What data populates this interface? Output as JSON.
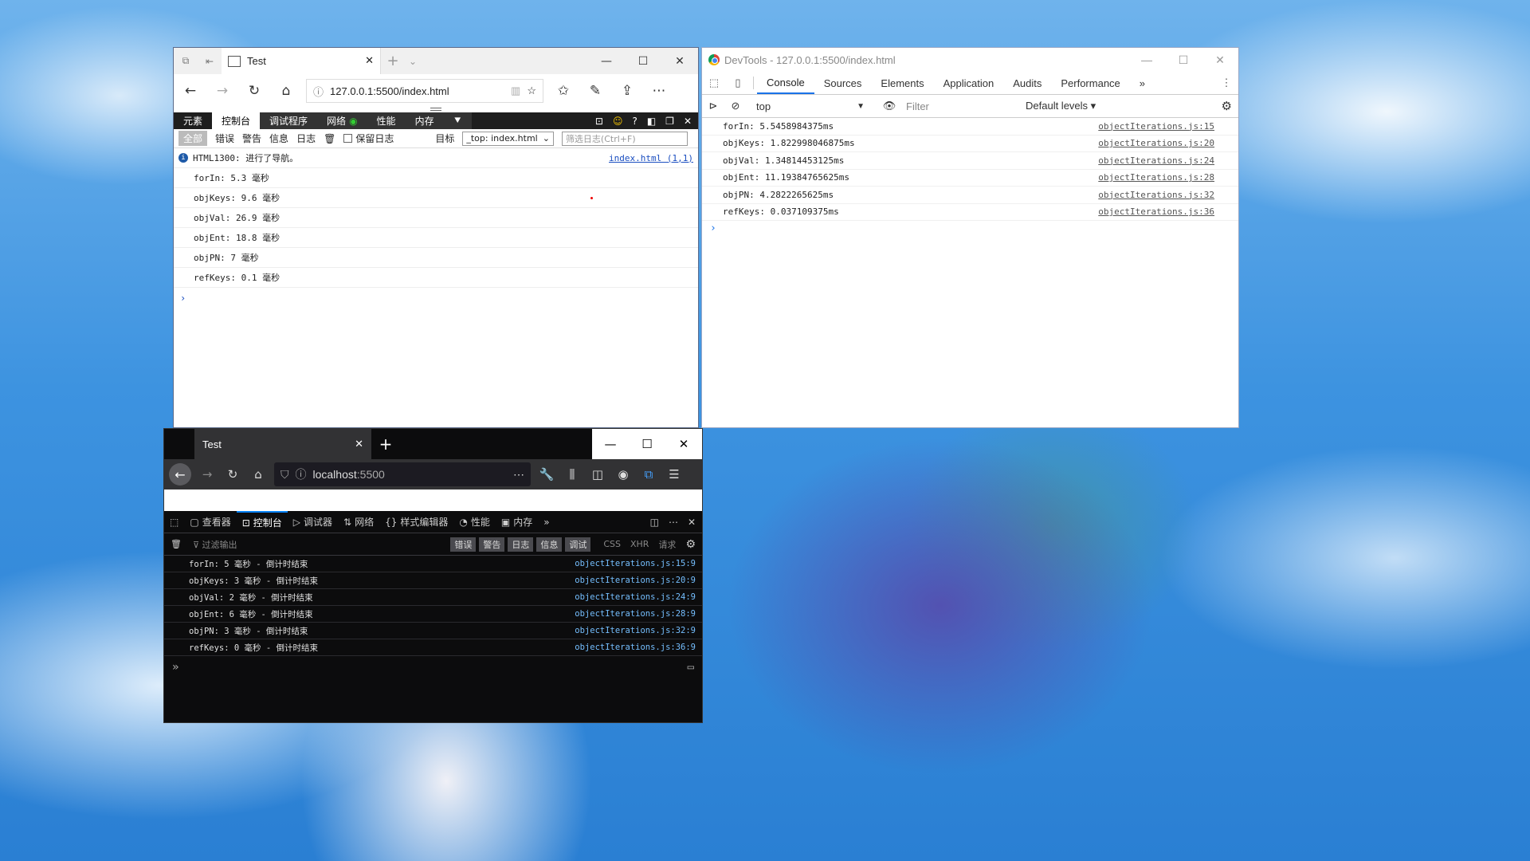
{
  "edge": {
    "tab_title": "Test",
    "url": "127.0.0.1:5500/index.html",
    "devtools_tabs": [
      "元素",
      "控制台",
      "调试程序",
      "网络",
      "性能",
      "内存"
    ],
    "filter_chips": [
      "全部",
      "错误",
      "警告",
      "信息",
      "日志"
    ],
    "preserve_log_label": "保留日志",
    "target_label": "目标",
    "target_value": "_top: index.html",
    "filter_placeholder": "筛选日志(Ctrl+F)",
    "info_message": "HTML1300: 进行了导航。",
    "info_source": "index.html (1,1)",
    "logs": [
      "forIn: 5.3 毫秒",
      "objKeys: 9.6 毫秒",
      "objVal: 26.9 毫秒",
      "objEnt: 18.8 毫秒",
      "objPN: 7 毫秒",
      "refKeys: 0.1 毫秒"
    ],
    "prompt": "›"
  },
  "chrome": {
    "title": "DevTools - 127.0.0.1:5500/index.html",
    "tabs": [
      "Console",
      "Sources",
      "Elements",
      "Application",
      "Audits",
      "Performance",
      "»"
    ],
    "context": "top",
    "filter_placeholder": "Filter",
    "levels": "Default levels ▾",
    "logs": [
      {
        "text": "forIn: 5.5458984375ms",
        "src": "objectIterations.js:15"
      },
      {
        "text": "objKeys: 1.822998046875ms",
        "src": "objectIterations.js:20"
      },
      {
        "text": "objVal: 1.34814453125ms",
        "src": "objectIterations.js:24"
      },
      {
        "text": "objEnt: 11.19384765625ms",
        "src": "objectIterations.js:28"
      },
      {
        "text": "objPN: 4.2822265625ms",
        "src": "objectIterations.js:32"
      },
      {
        "text": "refKeys: 0.037109375ms",
        "src": "objectIterations.js:36"
      }
    ],
    "prompt": "›"
  },
  "firefox": {
    "tab_title": "Test",
    "url_host": "localhost",
    "url_port": ":5500",
    "devtools_tabs": [
      "查看器",
      "控制台",
      "调试器",
      "网络",
      "样式编辑器",
      "性能",
      "内存"
    ],
    "filter_placeholder": "过滤输出",
    "chips": [
      "错误",
      "警告",
      "日志",
      "信息",
      "调试"
    ],
    "extra_filters": [
      "CSS",
      "XHR",
      "请求"
    ],
    "logs": [
      {
        "text": "forIn: 5 毫秒 - 倒计时结束",
        "src": "objectIterations.js:15:9"
      },
      {
        "text": "objKeys: 3 毫秒 - 倒计时结束",
        "src": "objectIterations.js:20:9"
      },
      {
        "text": "objVal: 2 毫秒 - 倒计时结束",
        "src": "objectIterations.js:24:9"
      },
      {
        "text": "objEnt: 6 毫秒 - 倒计时结束",
        "src": "objectIterations.js:28:9"
      },
      {
        "text": "objPN: 3 毫秒 - 倒计时结束",
        "src": "objectIterations.js:32:9"
      },
      {
        "text": "refKeys: 0 毫秒 - 倒计时结束",
        "src": "objectIterations.js:36:9"
      }
    ],
    "prompt": "»"
  },
  "icons": {
    "edge_tab_icons": [
      "tab-preview-icon",
      "tab-aside-icon",
      "page-icon"
    ],
    "chrome_icons": [
      "inspect-icon",
      "device-icon",
      "sidebar-icon",
      "clear-icon",
      "eye-icon",
      "settings-icon"
    ],
    "firefox_icons": [
      "picker-icon",
      "trash-icon",
      "settings-icon"
    ]
  }
}
